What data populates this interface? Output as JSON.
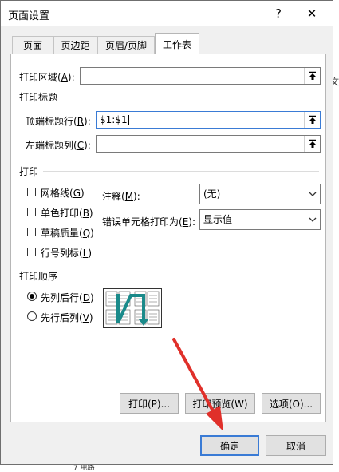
{
  "dialog": {
    "title": "页面设置",
    "help_label": "?",
    "close_label": "✕"
  },
  "tabs": [
    {
      "label": "页面"
    },
    {
      "label": "页边距"
    },
    {
      "label": "页眉/页脚"
    },
    {
      "label": "工作表"
    }
  ],
  "print_area": {
    "label": "打印区域(",
    "accel": "A",
    "label_end": "):",
    "value": ""
  },
  "print_titles": {
    "section": "打印标题",
    "rows_label": "顶端标题行(",
    "rows_accel": "R",
    "rows_end": "):",
    "rows_value": "$1:$1",
    "cols_label": "左端标题列(",
    "cols_accel": "C",
    "cols_end": "):",
    "cols_value": ""
  },
  "print": {
    "section": "打印",
    "options": [
      {
        "label": "网格线(",
        "accel": "G",
        "end": ")",
        "checked": false
      },
      {
        "label": "单色打印(",
        "accel": "B",
        "end": ")",
        "checked": false
      },
      {
        "label": "草稿质量(",
        "accel": "Q",
        "end": ")",
        "checked": false
      },
      {
        "label": "行号列标(",
        "accel": "L",
        "end": ")",
        "checked": false
      }
    ],
    "comments_label": "注释(",
    "comments_accel": "M",
    "comments_end": "):",
    "comments_value": "(无)",
    "errors_label": "错误单元格打印为(",
    "errors_accel": "E",
    "errors_end": "):",
    "errors_value": "显示值"
  },
  "page_order": {
    "section": "打印顺序",
    "down_then_over": {
      "label": "先列后行(",
      "accel": "D",
      "end": ")",
      "selected": true
    },
    "over_then_down": {
      "label": "先行后列(",
      "accel": "V",
      "end": ")",
      "selected": false
    }
  },
  "buttons": {
    "print": "打印(P)...",
    "preview": "打印预览(W)",
    "options": "选项(O)...",
    "ok": "确定",
    "cancel": "取消"
  },
  "background": {
    "text_right": "文",
    "text_bottom": "7 电路"
  },
  "colors": {
    "accent": "#3a7bd5",
    "annotation_arrow": "#e0302a",
    "order_arrow": "#1a8a8a"
  }
}
